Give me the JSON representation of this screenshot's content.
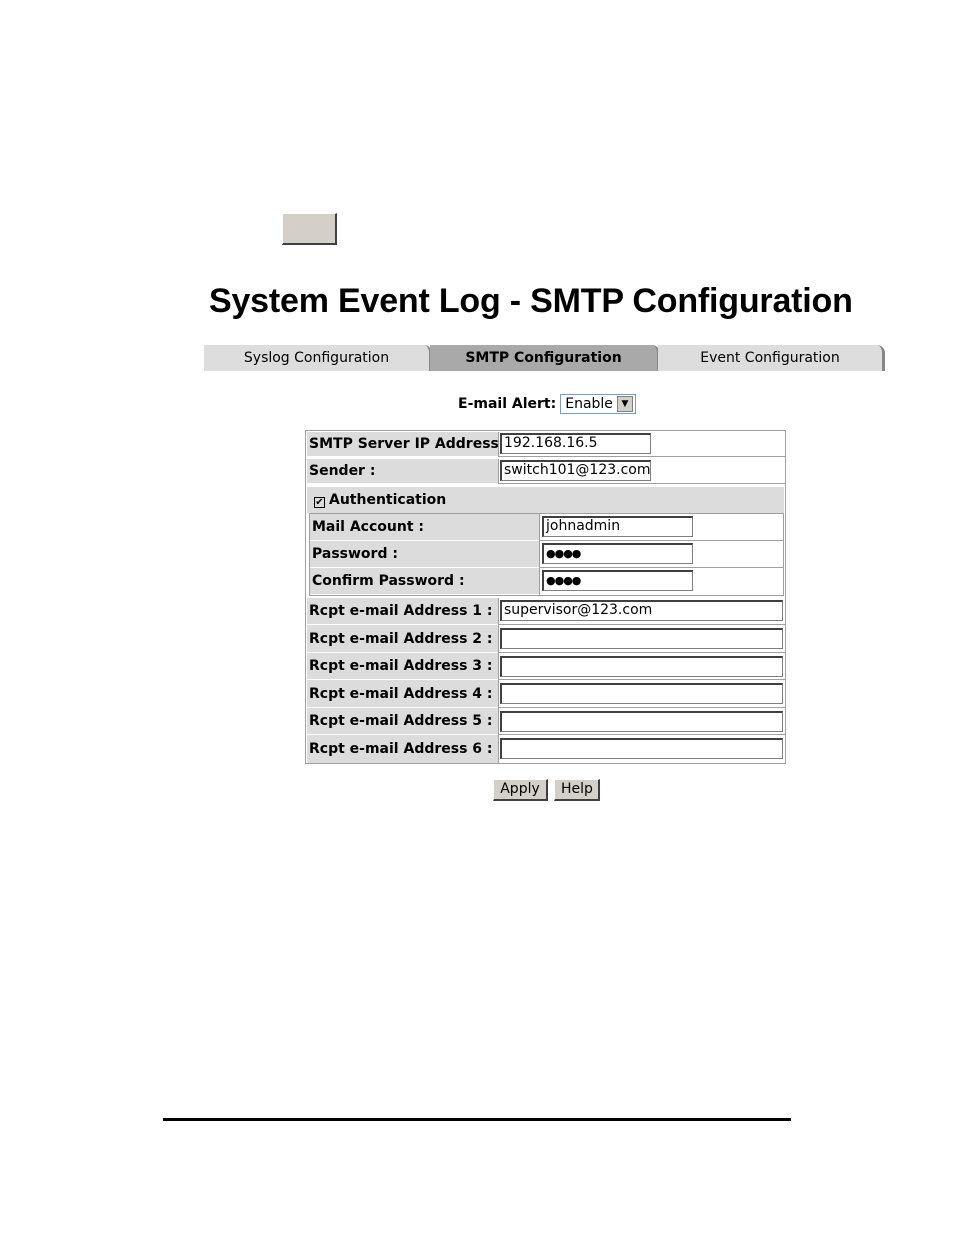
{
  "page": {
    "title": "System Event Log - SMTP Configuration"
  },
  "tabs": [
    {
      "label": "Syslog Configuration",
      "active": false
    },
    {
      "label": "SMTP Configuration",
      "active": true
    },
    {
      "label": "Event Configuration",
      "active": false
    }
  ],
  "email_alert": {
    "label": "E-mail Alert:",
    "selected": "Enable"
  },
  "form": {
    "smtp_server": {
      "label": "SMTP Server IP Address :",
      "value": "192.168.16.5"
    },
    "sender": {
      "label": "Sender :",
      "value": "switch101@123.com"
    },
    "authentication": {
      "label": "Authentication",
      "checked": true,
      "check_glyph": "✔"
    },
    "mail_account": {
      "label": "Mail Account :",
      "value": "johnadmin"
    },
    "password": {
      "label": "Password :",
      "value": "●●●●"
    },
    "confirm_password": {
      "label": "Confirm Password :",
      "value": "●●●●"
    },
    "rcpt": [
      {
        "label": "Rcpt e-mail Address 1 :",
        "value": "supervisor@123.com"
      },
      {
        "label": "Rcpt e-mail Address 2 :",
        "value": ""
      },
      {
        "label": "Rcpt e-mail Address 3 :",
        "value": ""
      },
      {
        "label": "Rcpt e-mail Address 4 :",
        "value": ""
      },
      {
        "label": "Rcpt e-mail Address 5 :",
        "value": ""
      },
      {
        "label": "Rcpt e-mail Address 6 :",
        "value": ""
      }
    ]
  },
  "buttons": {
    "apply": "Apply",
    "help": "Help"
  },
  "colors": {
    "label_bg": "#dcdcdc",
    "active_tab_bg": "#a9a9a9",
    "button_face": "#d4d0c8"
  }
}
